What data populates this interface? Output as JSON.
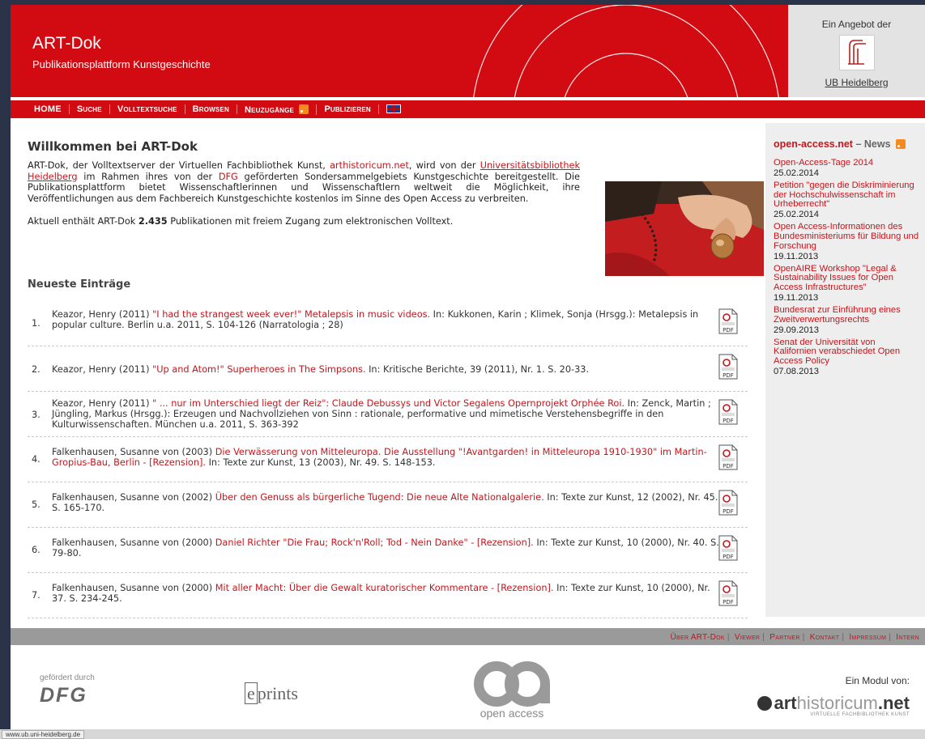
{
  "header": {
    "title": "ART-Dok",
    "subtitle": "Publikationsplattform Kunstgeschichte",
    "provider_top": "Ein Angebot der",
    "provider_name": "UB Heidelberg"
  },
  "nav": {
    "items": [
      "HOME",
      "Suche",
      "Volltextsuche",
      "Browsen",
      "Neuzugänge",
      "Publizieren"
    ]
  },
  "intro": {
    "title": "Willkommen bei ART-Dok",
    "p1_a": "ART-Dok, der Volltextserver der Virtuellen Fachbibliothek Kunst, ",
    "link1": "arthistoricum.net",
    "p1_b": ", wird von der ",
    "link2": "Universitätsbibliothek Heidelberg",
    "p1_c": " im Rahmen ihres von der ",
    "link3": "DFG",
    "p1_d": " geförderten Sondersammelgebiets Kunstgeschichte bereitgestellt. Die Publikationsplattform bietet Wissenschaftlerinnen und Wissenschaftlern weltweit die Möglichkeit, ihre Veröffentlichungen aus dem Fachbereich Kunstgeschichte kostenlos im Sinne des Open Access zu verbreiten.",
    "count_pre": "Aktuell enthält ART-Dok ",
    "count_num": "2.435",
    "count_post": " Publikationen mit freiem Zugang zum elektronischen Volltext."
  },
  "newest": {
    "title": "Neueste Einträge",
    "entries": [
      {
        "num": "1.",
        "author": "Keazor, Henry (2011) ",
        "title": "\"I had the strangest week ever!\" Metalepsis in music videos.",
        "rest": " In: Kukkonen, Karin ; Klimek, Sonja (Hrsgg.): Metalepsis in popular culture. Berlin u.a. 2011, S. 104-126 (Narratologia ; 28)"
      },
      {
        "num": "2.",
        "author": "Keazor, Henry (2011) ",
        "title": "\"Up and Atom!\" Superheroes in The Simpsons.",
        "rest": " In: Kritische Berichte, 39 (2011), Nr. 1. S. 20-33."
      },
      {
        "num": "3.",
        "author": "Keazor, Henry (2011) ",
        "title": "\" ... nur im Unterschied liegt der Reiz\": Claude Debussys und Victor Segalens Opernprojekt Orphée Roi.",
        "rest": " In: Zenck, Martin ; Jüngling, Markus (Hrsgg.): Erzeugen und Nachvollziehen von Sinn : rationale, performative und mimetische Verstehensbegriffe in den Kulturwissenschaften. München u.a. 2011, S. 363-392"
      },
      {
        "num": "4.",
        "author": "Falkenhausen, Susanne von (2003) ",
        "title": "Die Verwässerung von Mitteleuropa. Die Ausstellung \"!Avantgarden! in Mitteleuropa 1910-1930\" im Martin-Gropius-Bau, Berlin - [Rezension].",
        "rest": " In: Texte zur Kunst, 13 (2003), Nr. 49. S. 148-153."
      },
      {
        "num": "5.",
        "author": "Falkenhausen, Susanne von (2002) ",
        "title": "Über den Genuss als bürgerliche Tugend: Die neue Alte Nationalgalerie.",
        "rest": " In: Texte zur Kunst, 12 (2002), Nr. 45. S. 165-170."
      },
      {
        "num": "6.",
        "author": "Falkenhausen, Susanne von (2000) ",
        "title": "Daniel Richter \"Die Frau; Rock'n'Roll; Tod - Nein Danke\" - [Rezension].",
        "rest": " In: Texte zur Kunst, 10 (2000), Nr. 40. S. 79-80."
      },
      {
        "num": "7.",
        "author": "Falkenhausen, Susanne von (2000) ",
        "title": "Mit aller Macht: Über die Gewalt kuratorischer Kommentare - [Rezension].",
        "rest": " In: Texte zur Kunst, 10 (2000), Nr. 37. S. 234-245."
      }
    ],
    "pdf_label": "PDF"
  },
  "sidebar": {
    "title": "open-access.net",
    "title_suffix": " – News",
    "news": [
      {
        "title": "Open-Access-Tage 2014",
        "date": "25.02.2014"
      },
      {
        "title": "Petition \"gegen die Diskriminierung der Hochschulwissenschaft im Urheberrecht\"",
        "date": "25.02.2014"
      },
      {
        "title": "Open Access-Informationen des Bundesministeriums für Bildung und Forschung",
        "date": "19.11.2013"
      },
      {
        "title": "OpenAIRE Workshop \"Legal & Sustainability Issues for Open Access Infrastructures\"",
        "date": "19.11.2013"
      },
      {
        "title": "Bundesrat zur Einführung eines Zweitverwertungsrechts",
        "date": "29.09.2013"
      },
      {
        "title": "Senat der Universität von Kalifornien verabschiedet Open Access Policy",
        "date": "07.08.2013"
      }
    ]
  },
  "footer": {
    "links": [
      "Über ART-Dok",
      "Viewer",
      "Partner",
      "Kontakt",
      "Impressum",
      "Intern"
    ],
    "dfg_small": "gefördert durch",
    "dfg_big": "DFG",
    "eprints_e": "e",
    "eprints_rest": "prints",
    "oa_text": "open access",
    "modul_label": "Ein Modul von:",
    "ah_bold": "art",
    "ah_rest": "historicum",
    "ah_net": ".net",
    "ah_sub": "VIRTUELLE FACHBIBLIOTHEK KUNST"
  },
  "status": {
    "url": "www.ub.uni-heidelberg.de"
  },
  "colors": {
    "brand_red": "#d20a11",
    "link_red": "#c4161c"
  }
}
